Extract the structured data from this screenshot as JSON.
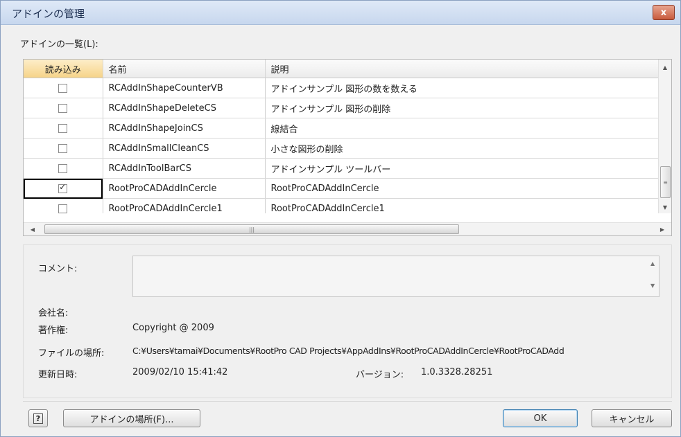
{
  "window": {
    "title": "アドインの管理",
    "close_label": "x"
  },
  "list_label": "アドインの一覧(L):",
  "columns": [
    "読み込み",
    "名前",
    "説明"
  ],
  "rows": [
    {
      "checked": false,
      "name": "RCAddInShapeCounterVB",
      "desc": "アドインサンプル 図形の数を数える"
    },
    {
      "checked": false,
      "name": "RCAddInShapeDeleteCS",
      "desc": "アドインサンプル 図形の削除"
    },
    {
      "checked": false,
      "name": "RCAddInShapeJoinCS",
      "desc": "線結合"
    },
    {
      "checked": false,
      "name": "RCAddInSmallCleanCS",
      "desc": "小さな図形の削除"
    },
    {
      "checked": false,
      "name": "RCAddInToolBarCS",
      "desc": "アドインサンプル ツールバー"
    },
    {
      "checked": true,
      "name": "RootProCADAddInCercle",
      "desc": "RootProCADAddInCercle"
    },
    {
      "checked": false,
      "name": "RootProCADAddInCercle1",
      "desc": "RootProCADAddInCercle1"
    }
  ],
  "details": {
    "comment_label": "コメント:",
    "comment_value": "",
    "company_label": "会社名:",
    "company_value": "",
    "copyright_label": "著作権:",
    "copyright_value": "Copyright @  2009",
    "location_label": "ファイルの場所:",
    "location_value": "C:¥Users¥tamai¥Documents¥RootPro CAD Projects¥AppAddIns¥RootProCADAddInCercle¥RootProCADAdd",
    "updated_label": "更新日時:",
    "updated_value": "2009/02/10 15:41:42",
    "version_label": "バージョン:",
    "version_value": "1.0.3328.28251"
  },
  "buttons": {
    "help": "?",
    "addin_location": "アドインの場所(F)...",
    "ok": "OK",
    "cancel": "キャンセル"
  },
  "icons": {
    "close": "close-icon",
    "help": "help-icon",
    "scroll_up": "scroll-up-arrow-icon",
    "scroll_down": "scroll-down-arrow-icon",
    "scroll_left": "scroll-left-arrow-icon",
    "scroll_right": "scroll-right-arrow-icon"
  }
}
